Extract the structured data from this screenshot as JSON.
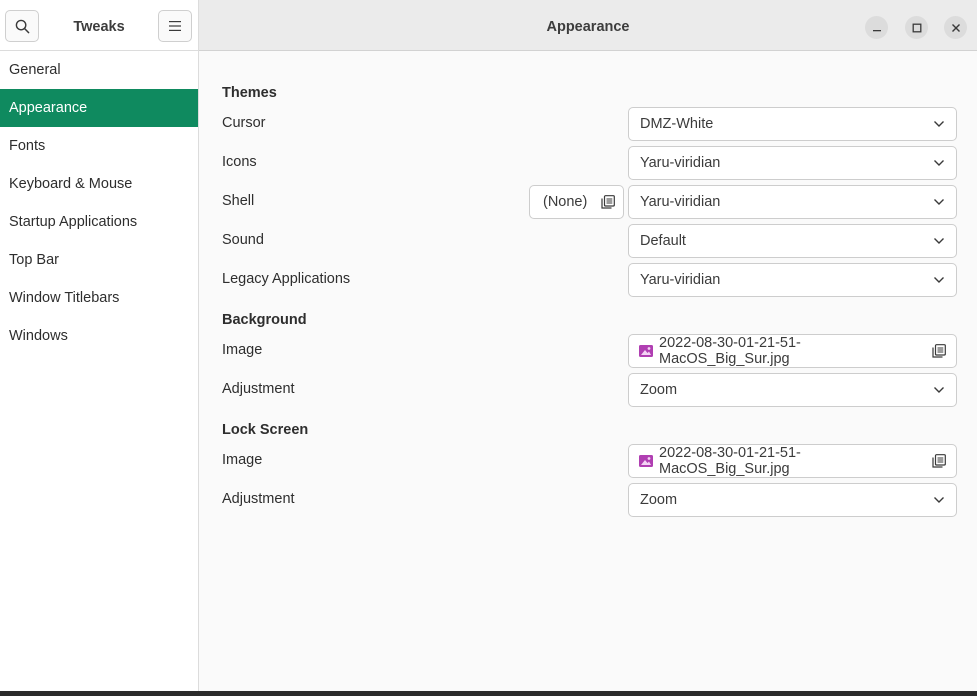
{
  "header": {
    "app_title": "Tweaks",
    "page_title": "Appearance"
  },
  "sidebar": {
    "items": [
      {
        "label": "General"
      },
      {
        "label": "Appearance"
      },
      {
        "label": "Fonts"
      },
      {
        "label": "Keyboard & Mouse"
      },
      {
        "label": "Startup Applications"
      },
      {
        "label": "Top Bar"
      },
      {
        "label": "Window Titlebars"
      },
      {
        "label": "Windows"
      }
    ],
    "active_index": 1
  },
  "themes": {
    "section": "Themes",
    "cursor": {
      "label": "Cursor",
      "value": "DMZ-White"
    },
    "icons": {
      "label": "Icons",
      "value": "Yaru-viridian"
    },
    "shell": {
      "label": "Shell",
      "file": "(None)",
      "value": "Yaru-viridian"
    },
    "sound": {
      "label": "Sound",
      "value": "Default"
    },
    "legacy": {
      "label": "Legacy Applications",
      "value": "Yaru-viridian"
    }
  },
  "background": {
    "section": "Background",
    "image": {
      "label": "Image",
      "value": "2022-08-30-01-21-51-MacOS_Big_Sur.jpg"
    },
    "adjustment": {
      "label": "Adjustment",
      "value": "Zoom"
    }
  },
  "lock_screen": {
    "section": "Lock Screen",
    "image": {
      "label": "Image",
      "value": "2022-08-30-01-21-51-MacOS_Big_Sur.jpg"
    },
    "adjustment": {
      "label": "Adjustment",
      "value": "Zoom"
    }
  },
  "colors": {
    "accent": "#0f8a5f",
    "image_icon": "#b03fb2"
  }
}
